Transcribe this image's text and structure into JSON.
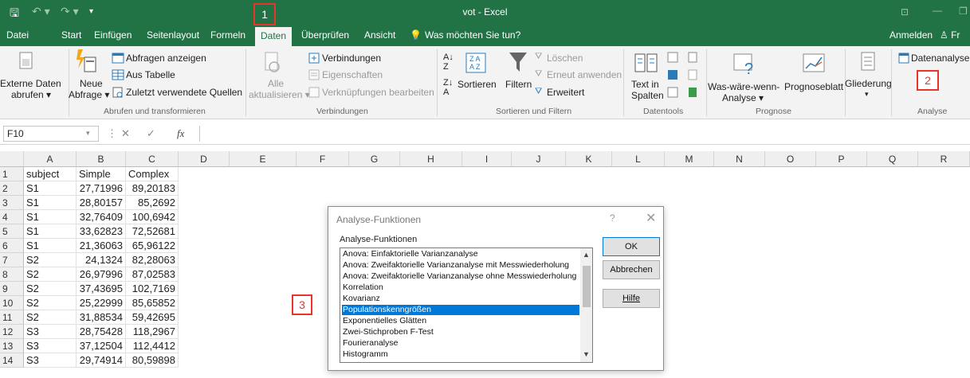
{
  "titlebar": {
    "title": "vot - Excel",
    "save_icon": "save-icon",
    "undo_icon": "undo-icon",
    "redo_icon": "redo-icon",
    "bg": "#217346"
  },
  "tabs": [
    "Datei",
    "Start",
    "Einfügen",
    "Seitenlayout",
    "Formeln",
    "Daten",
    "Überprüfen",
    "Ansicht",
    "Was möchten Sie tun?"
  ],
  "account": {
    "signin": "Anmelden",
    "share": "Fr"
  },
  "ribbon": {
    "externe_daten": [
      "Externe Daten",
      "abrufen ▾"
    ],
    "neue_abfrage": [
      "Neue",
      "Abfrage ▾"
    ],
    "abfragen_anzeigen": "Abfragen anzeigen",
    "aus_tabelle": "Aus Tabelle",
    "zuletzt": "Zuletzt verwendete Quellen",
    "group1": "Abrufen und transformieren",
    "alle": [
      "Alle",
      "aktualisieren ▾"
    ],
    "verbindungen": "Verbindungen",
    "eigenschaften": "Eigenschaften",
    "verknuepfungen": "Verknüpfungen bearbeiten",
    "group2": "Verbindungen",
    "sortieren": "Sortieren",
    "filtern": "Filtern",
    "loeschen": "Löschen",
    "erneut": "Erneut anwenden",
    "erweitert": "Erweitert",
    "group3": "Sortieren und Filtern",
    "text_in": [
      "Text in",
      "Spalten"
    ],
    "group4": "Datentools",
    "waswaere": [
      "Was-wäre-wenn-",
      "Analyse ▾"
    ],
    "prognoseblatt": "Prognoseblatt",
    "group5": "Prognose",
    "gliederung": "Gliederung",
    "datenanalyse": "Datenanalyse",
    "group6": "Analyse"
  },
  "formula_bar": {
    "name_box": "F10",
    "cancel_icon": "✕",
    "enter_icon": "✓",
    "fx": "fx",
    "value": ""
  },
  "columns": [
    "A",
    "B",
    "C",
    "D",
    "E",
    "F",
    "G",
    "H",
    "I",
    "J",
    "K",
    "L",
    "M",
    "N",
    "O",
    "P",
    "Q",
    "R"
  ],
  "rows": [
    {
      "n": "1",
      "a": "subject",
      "b": "Simple",
      "c": "Complex"
    },
    {
      "n": "2",
      "a": "S1",
      "b": "27,71996",
      "c": "89,20183"
    },
    {
      "n": "3",
      "a": "S1",
      "b": "28,80157",
      "c": "85,2692"
    },
    {
      "n": "4",
      "a": "S1",
      "b": "32,76409",
      "c": "100,6942"
    },
    {
      "n": "5",
      "a": "S1",
      "b": "33,62823",
      "c": "72,52681"
    },
    {
      "n": "6",
      "a": "S1",
      "b": "21,36063",
      "c": "65,96122"
    },
    {
      "n": "7",
      "a": "S2",
      "b": "24,1324",
      "c": "82,28063"
    },
    {
      "n": "8",
      "a": "S2",
      "b": "26,97996",
      "c": "87,02583"
    },
    {
      "n": "9",
      "a": "S2",
      "b": "37,43695",
      "c": "102,7169"
    },
    {
      "n": "10",
      "a": "S2",
      "b": "25,22999",
      "c": "85,65852"
    },
    {
      "n": "11",
      "a": "S2",
      "b": "31,88534",
      "c": "59,42695"
    },
    {
      "n": "12",
      "a": "S3",
      "b": "28,75428",
      "c": "118,2967"
    },
    {
      "n": "13",
      "a": "S3",
      "b": "37,12504",
      "c": "112,4412"
    },
    {
      "n": "14",
      "a": "S3",
      "b": "29,74914",
      "c": "80,59898"
    }
  ],
  "markers": [
    "1",
    "2",
    "3"
  ],
  "dialog": {
    "title": "Analyse-Funktionen",
    "help_glyph": "?",
    "close_glyph": "✕",
    "list_label": "Analyse-Funktionen",
    "items": [
      "Anova: Einfaktorielle Varianzanalyse",
      "Anova: Zweifaktorielle Varianzanalyse mit Messwiederholung",
      "Anova: Zweifaktorielle Varianzanalyse ohne Messwiederholung",
      "Korrelation",
      "Kovarianz",
      "Populationskenngrößen",
      "Exponentielles Glätten",
      "Zwei-Stichproben F-Test",
      "Fourieranalyse",
      "Histogramm"
    ],
    "selected_index": 5,
    "ok": "OK",
    "cancel": "Abbrechen",
    "help": "Hilfe"
  }
}
